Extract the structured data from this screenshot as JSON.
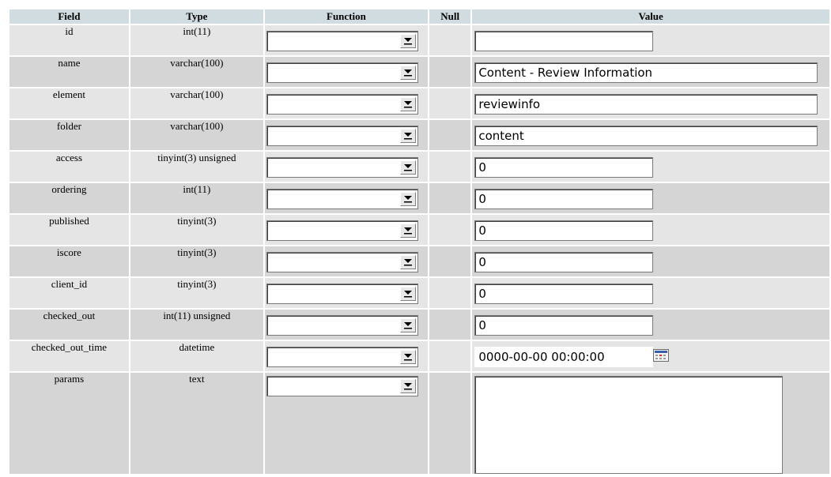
{
  "headers": {
    "field": "Field",
    "type": "Type",
    "function": "Function",
    "null": "Null",
    "value": "Value"
  },
  "rows": [
    {
      "field": "id",
      "type": "int(11)",
      "value": ""
    },
    {
      "field": "name",
      "type": "varchar(100)",
      "value": "Content - Review Information"
    },
    {
      "field": "element",
      "type": "varchar(100)",
      "value": "reviewinfo"
    },
    {
      "field": "folder",
      "type": "varchar(100)",
      "value": "content"
    },
    {
      "field": "access",
      "type": "tinyint(3) unsigned",
      "value": "0"
    },
    {
      "field": "ordering",
      "type": "int(11)",
      "value": "0"
    },
    {
      "field": "published",
      "type": "tinyint(3)",
      "value": "0"
    },
    {
      "field": "iscore",
      "type": "tinyint(3)",
      "value": "0"
    },
    {
      "field": "client_id",
      "type": "tinyint(3)",
      "value": "0"
    },
    {
      "field": "checked_out",
      "type": "int(11) unsigned",
      "value": "0"
    },
    {
      "field": "checked_out_time",
      "type": "datetime",
      "value": "0000-00-00 00:00:00"
    },
    {
      "field": "params",
      "type": "text",
      "value": ""
    }
  ],
  "icons": {
    "dropdown": "chevron-down-icon",
    "calendar": "calendar-icon"
  },
  "colors": {
    "header_bg": "#d0dce0",
    "row_light": "#e5e5e5",
    "row_dark": "#d5d5d5"
  }
}
